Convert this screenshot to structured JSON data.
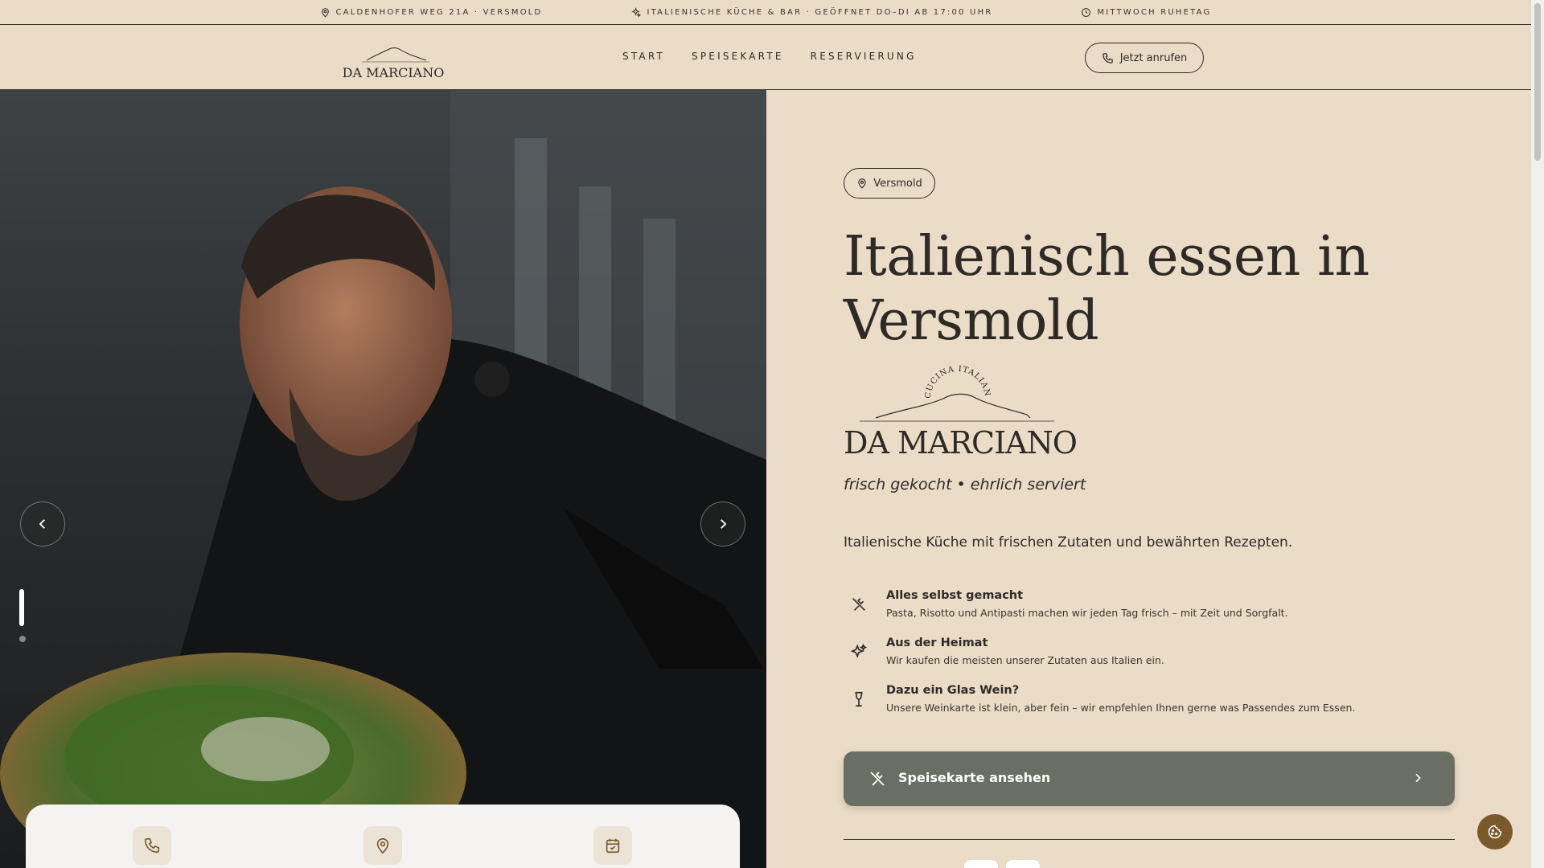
{
  "topbar": {
    "address": "Caldenhofer Weg 21a · Versmold",
    "cuisine": "Italienische Küche & Bar · Geöffnet Do–Di ab 17:00 Uhr",
    "rest_day": "Mittwoch Ruhetag"
  },
  "logo": {
    "brand": "DA MARCIANO",
    "arc_text": "CUCINA ITALIANA"
  },
  "nav": {
    "items": [
      "START",
      "SPEISEKARTE",
      "RESERVIERUNG"
    ],
    "call_label": "Jetzt anrufen"
  },
  "hero": {
    "location_pill": "Versmold",
    "headline_line1": "Italienisch essen in",
    "headline_line2": "Versmold",
    "tagline": "frisch gekocht • ehrlich serviert",
    "intro": "Italienische Küche mit frischen Zutaten und bewährten Rezepten.",
    "features": [
      {
        "icon": "cutlery-icon",
        "title": "Alles selbst gemacht",
        "desc": "Pasta, Risotto und Antipasti machen wir jeden Tag frisch – mit Zeit und Sorgfalt."
      },
      {
        "icon": "sparkle-icon",
        "title": "Aus der Heimat",
        "desc": "Wir kaufen die meisten unserer Zutaten aus Italien ein."
      },
      {
        "icon": "wine-glass-icon",
        "title": "Dazu ein Glas Wein?",
        "desc": "Unsere Weinkarte ist klein, aber fein – wir empfehlen Ihnen gerne was Passendes zum Essen."
      }
    ],
    "menu_button": "Speisekarte ansehen"
  },
  "colors": {
    "background": "#ebdcc8",
    "text": "#2e2a26",
    "button_green": "#6b6e62",
    "cookie_brown": "#7a5a2c"
  }
}
